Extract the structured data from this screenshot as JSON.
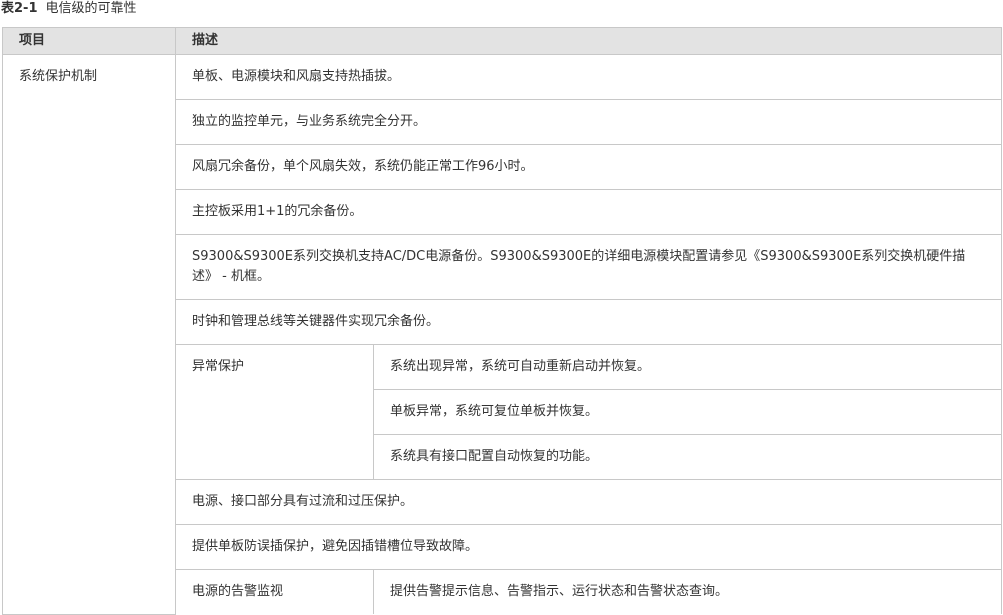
{
  "caption": {
    "number": "表2-1",
    "title": "电信级的可靠性"
  },
  "table": {
    "headers": [
      "项目",
      "描述"
    ],
    "item": "系统保护机制",
    "rows": [
      "单板、电源模块和风扇支持热插拔。",
      "独立的监控单元，与业务系统完全分开。",
      "风扇冗余备份，单个风扇失效，系统仍能正常工作96小时。",
      "主控板采用1+1的冗余备份。",
      "S9300&S9300E系列交换机支持AC/DC电源备份。S9300&S9300E的详细电源模块配置请参见《S9300&S9300E系列交换机硬件描述》 - 机框。",
      "时钟和管理总线等关键器件实现冗余备份。"
    ],
    "exception": {
      "label": "异常保护",
      "items": [
        "系统出现异常，系统可自动重新启动并恢复。",
        "单板异常，系统可复位单板并恢复。",
        "系统具有接口配置自动恢复的功能。"
      ]
    },
    "rows_after": [
      "电源、接口部分具有过流和过压保护。",
      "提供单板防误插保护，避免因插错槽位导致故障。"
    ],
    "alarm": {
      "label": "电源的告警监视",
      "desc": "提供告警提示信息、告警指示、运行状态和告警状态查询。"
    }
  }
}
